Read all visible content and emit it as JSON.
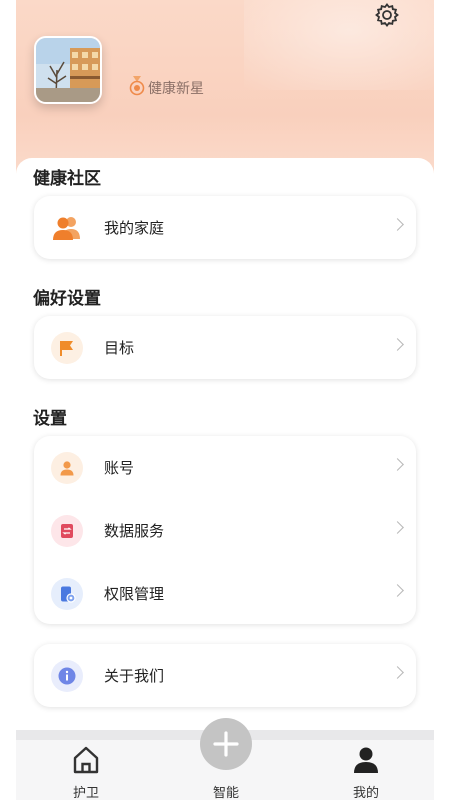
{
  "header": {
    "badge_text": "健康新星",
    "settings_icon": "gear-icon",
    "avatar": "building-photo"
  },
  "sections": [
    {
      "title": "健康社区",
      "items": [
        {
          "label": "我的家庭",
          "icon": "family-icon",
          "icon_color": "#ef8a3b"
        }
      ]
    },
    {
      "title": "偏好设置",
      "items": [
        {
          "label": "目标",
          "icon": "flag-icon",
          "icon_color": "#f08c2a"
        }
      ]
    },
    {
      "title": "设置",
      "items": [
        {
          "label": "账号",
          "icon": "user-icon",
          "icon_color": "#f2994a"
        },
        {
          "label": "数据服务",
          "icon": "data-service-icon",
          "icon_color": "#e04a5e"
        },
        {
          "label": "权限管理",
          "icon": "permission-icon",
          "icon_color": "#4a79e0"
        }
      ]
    },
    {
      "title": "",
      "items": [
        {
          "label": "关于我们",
          "icon": "info-icon",
          "icon_color": "#6f86e6"
        }
      ]
    }
  ],
  "tabbar": {
    "tabs": [
      {
        "label": "护卫",
        "icon": "home-icon",
        "active": false
      },
      {
        "label": "智能",
        "icon": "plus-icon",
        "active": false
      },
      {
        "label": "我的",
        "icon": "person-icon",
        "active": true
      }
    ]
  }
}
